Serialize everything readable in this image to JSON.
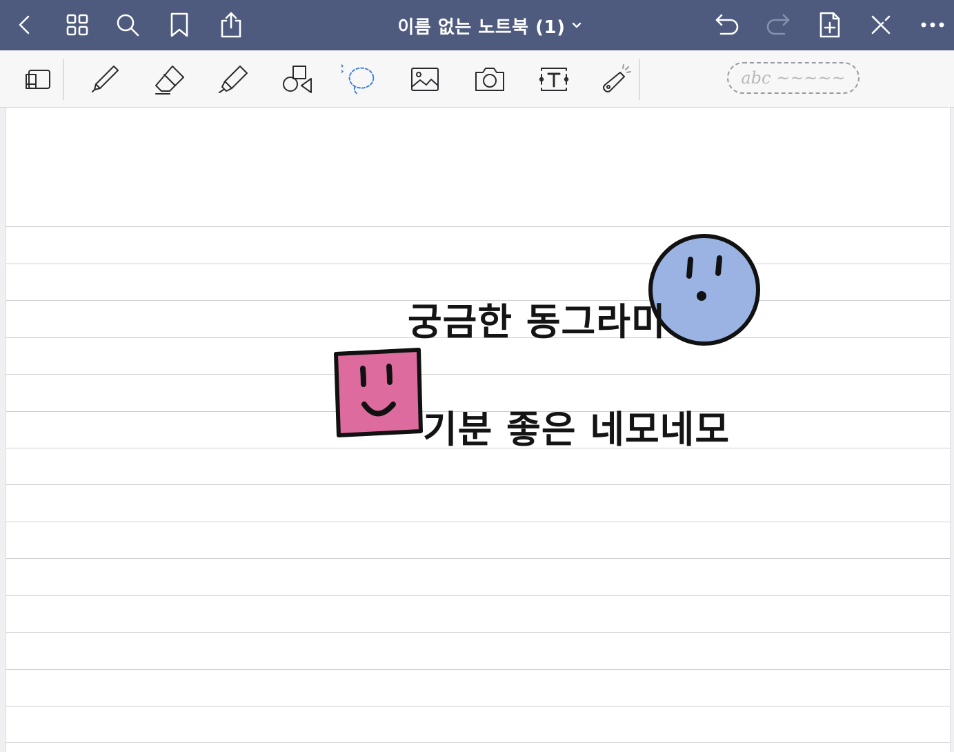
{
  "header": {
    "title": "이름 없는 노트북 (1)",
    "icons": [
      "back-icon",
      "grid-icon",
      "search-icon",
      "bookmark-icon",
      "share-icon",
      "chevron-down-icon",
      "undo-icon",
      "redo-icon",
      "add-page-icon",
      "close-pen-icon",
      "more-icon"
    ]
  },
  "toolbar": {
    "tools": [
      "page-view",
      "pen",
      "eraser",
      "highlighter",
      "shapes",
      "lasso",
      "image",
      "camera",
      "text",
      "laser-pointer"
    ],
    "handwriting_hint": "abc ~~~~~"
  },
  "canvas": {
    "caption_circle": "궁금한 동그라미",
    "caption_square": "기분 좋은 네모네모",
    "circle_color": "#9ab3e3",
    "square_color": "#de6b9d"
  }
}
